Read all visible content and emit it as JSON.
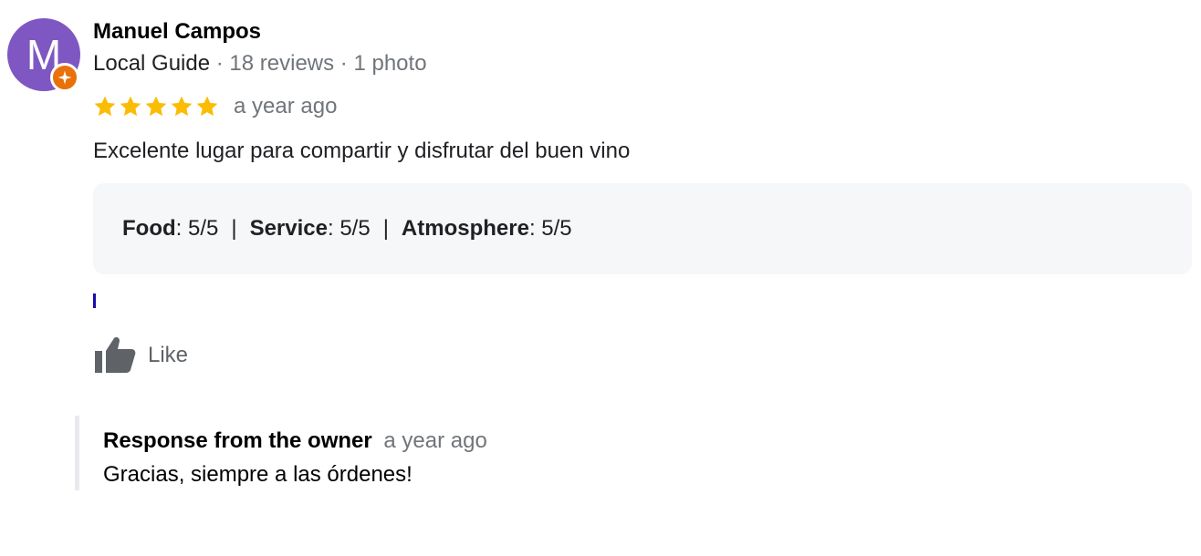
{
  "author": {
    "initial": "M",
    "name": "Manuel Campos",
    "guide_label": "Local Guide",
    "meta_sep": " · ",
    "reviews": "18 reviews",
    "photos": "1 photo",
    "avatar_color": "#7e57c2",
    "badge_color": "#e8710a",
    "badge_icon": "local-guide-star-icon"
  },
  "review": {
    "stars": 5,
    "star_color": "#fbbc04",
    "time": "a year ago",
    "text": "Excelente lugar para compartir y disfrutar del buen vino",
    "ratings": [
      {
        "label": "Food",
        "value": ": 5/5"
      },
      {
        "label": "Service",
        "value": ": 5/5"
      },
      {
        "label": "Atmosphere",
        "value": ": 5/5"
      }
    ],
    "ratings_sep": "|"
  },
  "actions": {
    "like_label": "Like",
    "like_icon": "thumbs-up-icon"
  },
  "owner_response": {
    "title": "Response from the owner",
    "time": "a year ago",
    "text": "Gracias, siempre a las órdenes!"
  }
}
